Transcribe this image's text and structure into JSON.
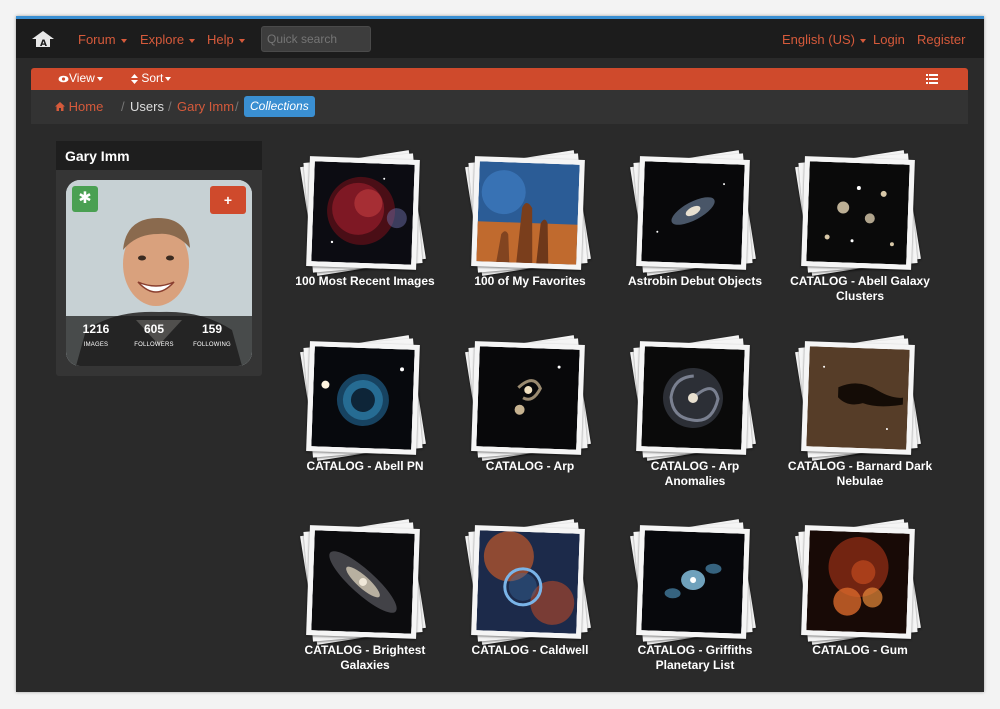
{
  "nav": {
    "forum": "Forum",
    "explore": "Explore",
    "help": "Help",
    "search_placeholder": "Quick search",
    "language": "English (US)",
    "login": "Login",
    "register": "Register"
  },
  "toolbar": {
    "view": "View",
    "sort": "Sort"
  },
  "breadcrumb": {
    "home": "Home",
    "users": "Users",
    "user": "Gary Imm",
    "current": "Collections"
  },
  "profile": {
    "name": "Gary Imm",
    "stats": [
      {
        "value": "1216",
        "label": "IMAGES"
      },
      {
        "value": "605",
        "label": "FOLLOWERS"
      },
      {
        "value": "159",
        "label": "FOLLOWING"
      }
    ]
  },
  "collections": [
    {
      "title": "100 Most Recent Images",
      "icon": "jellyfish-nebula-thumb"
    },
    {
      "title": "100 of My Favorites",
      "icon": "pillars-of-creation-thumb"
    },
    {
      "title": "Astrobin Debut Objects",
      "icon": "spiral-galaxy-thumb"
    },
    {
      "title": "CATALOG - Abell Galaxy Clusters",
      "icon": "galaxy-cluster-thumb"
    },
    {
      "title": "CATALOG - Abell PN",
      "icon": "planetary-nebula-thumb"
    },
    {
      "title": "CATALOG - Arp",
      "icon": "interacting-galaxies-thumb"
    },
    {
      "title": "CATALOG - Arp Anomalies",
      "icon": "face-on-spiral-thumb"
    },
    {
      "title": "CATALOG - Barnard Dark Nebulae",
      "icon": "dark-nebula-thumb"
    },
    {
      "title": "CATALOG - Brightest Galaxies",
      "icon": "andromeda-galaxy-thumb"
    },
    {
      "title": "CATALOG - Caldwell",
      "icon": "bubble-nebula-thumb"
    },
    {
      "title": "CATALOG - Griffiths Planetary List",
      "icon": "bipolar-nebula-thumb"
    },
    {
      "title": "CATALOG - Gum",
      "icon": "emission-nebula-thumb"
    }
  ],
  "colors": {
    "accent": "#cf4a2c",
    "link": "#d65a3b",
    "highlight": "#3a8fd2",
    "green": "#4aa052"
  }
}
